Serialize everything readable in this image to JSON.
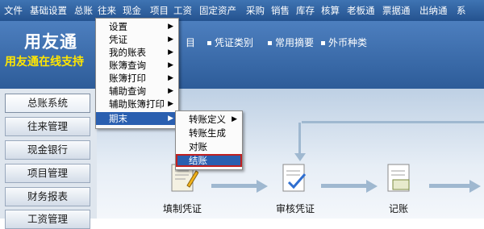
{
  "menubar": [
    "文件",
    "基础设置",
    "总账",
    "往来",
    "现金",
    "项目",
    "工资",
    "固定资产",
    "采购",
    "销售",
    "库存",
    "核算",
    "老板通",
    "票据通",
    "出纳通"
  ],
  "menubar_more": "系",
  "brand": {
    "title": "用友通",
    "subtitle": "用友通在线支持"
  },
  "tabs": [
    "目",
    "凭证类别",
    "常用摘要",
    "外币种类"
  ],
  "sidebar": [
    "总账系统",
    "往来管理",
    "现金银行",
    "项目管理",
    "财务报表",
    "工资管理"
  ],
  "menu_main": [
    "设置",
    "凭证",
    "我的账表",
    "账簿查询",
    "账簿打印",
    "辅助查询",
    "辅助账簿打印",
    "期末"
  ],
  "menu_sub": [
    "转账定义",
    "转账生成",
    "对账",
    "结账"
  ],
  "flow": [
    "填制凭证",
    "审核凭证",
    "记账"
  ],
  "colors": {
    "menubar": "#24528f",
    "highlight": "#2a5fb0",
    "selected_border": "#c02020",
    "brand_sub": "#ffe600"
  }
}
